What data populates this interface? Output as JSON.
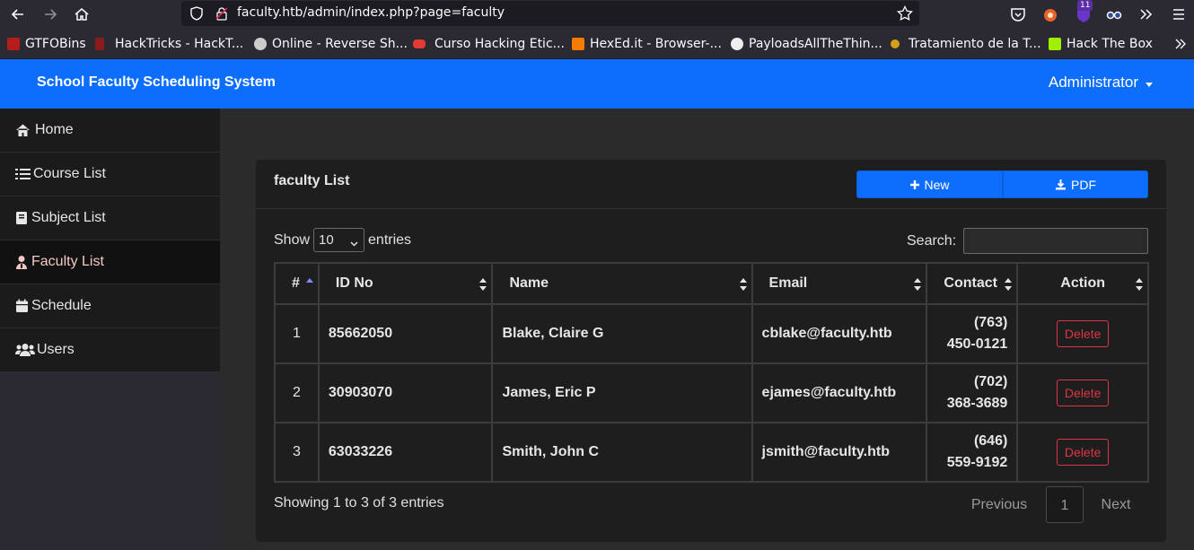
{
  "browser": {
    "url": "faculty.htb/admin/index.php?page=faculty",
    "extension_badge": "11",
    "bookmarks": [
      {
        "label": "GTFOBins",
        "color": "#b71c1c"
      },
      {
        "label": "HackTricks - HackT...",
        "color": "#8b1a1a"
      },
      {
        "label": "Online - Reverse Sh...",
        "color": "#cccccc"
      },
      {
        "label": "Curso Hacking Etic...",
        "color": "#e53935"
      },
      {
        "label": "HexEd.it - Browser-...",
        "color": "#f57c00"
      },
      {
        "label": "PayloadsAllTheThin...",
        "color": "#eeeeee"
      },
      {
        "label": "Tratamiento de la T...",
        "color": "#d4a017"
      },
      {
        "label": "Hack The Box",
        "color": "#9fef00"
      }
    ]
  },
  "header": {
    "brand": "School Faculty Scheduling System",
    "account": "Administrator",
    "color": "#0d6efd"
  },
  "sidebar": {
    "items": [
      {
        "label": "Home",
        "icon": "home-icon"
      },
      {
        "label": "Course List",
        "icon": "list-icon"
      },
      {
        "label": "Subject List",
        "icon": "book-icon"
      },
      {
        "label": "Faculty List",
        "icon": "user-tie-icon",
        "active": true
      },
      {
        "label": "Schedule",
        "icon": "calendar-icon"
      },
      {
        "label": "Users",
        "icon": "users-icon"
      }
    ]
  },
  "main": {
    "card_title": "faculty List",
    "new_label": "New",
    "pdf_label": "PDF",
    "show_label": "Show",
    "entries_label": "entries",
    "page_length": "10",
    "search_label": "Search:",
    "search_value": "",
    "columns": [
      "#",
      "ID No",
      "Name",
      "Email",
      "Contact",
      "Action"
    ],
    "rows": [
      {
        "num": "1",
        "id": "85662050",
        "name": "Blake, Claire G",
        "email": "cblake@faculty.htb",
        "contact1": "(763)",
        "contact2": "450-0121",
        "action": "Delete"
      },
      {
        "num": "2",
        "id": "30903070",
        "name": "James, Eric P",
        "email": "ejames@faculty.htb",
        "contact1": "(702)",
        "contact2": "368-3689",
        "action": "Delete"
      },
      {
        "num": "3",
        "id": "63033226",
        "name": "Smith, John C",
        "email": "jsmith@faculty.htb",
        "contact1": "(646)",
        "contact2": "559-9192",
        "action": "Delete"
      }
    ],
    "showing_text": "Showing 1 to 3 of 3 entries",
    "pagination": {
      "previous": "Previous",
      "current": "1",
      "next": "Next"
    }
  }
}
